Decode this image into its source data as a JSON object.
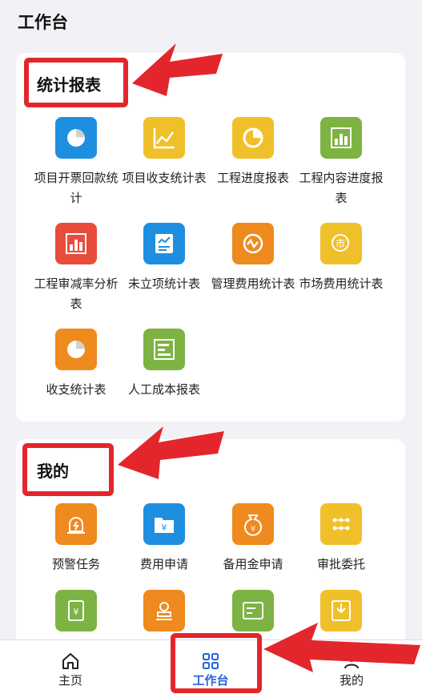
{
  "header": {
    "title": "工作台"
  },
  "reports": {
    "title": "统计报表",
    "items": [
      {
        "label": "项目开票回款统计",
        "icon": "pie-chart-icon",
        "color": "#1e8fe0"
      },
      {
        "label": "项目收支统计表",
        "icon": "line-chart-icon",
        "color": "#f0c02a"
      },
      {
        "label": "工程进度报表",
        "icon": "progress-pie-icon",
        "color": "#f0c02a"
      },
      {
        "label": "工程内容进度报表",
        "icon": "bar-chart-icon",
        "color": "#7cb342"
      },
      {
        "label": "工程审减率分析表",
        "icon": "bar-chart-icon",
        "color": "#e84c3d"
      },
      {
        "label": "未立项统计表",
        "icon": "report-icon",
        "color": "#1e8fe0"
      },
      {
        "label": "管理费用统计表",
        "icon": "cycle-icon",
        "color": "#ef8a1e"
      },
      {
        "label": "市场费用统计表",
        "icon": "market-icon",
        "color": "#f0c02a"
      },
      {
        "label": "收支统计表",
        "icon": "pie-chart-icon",
        "color": "#ef8a1e"
      },
      {
        "label": "人工成本报表",
        "icon": "gantt-icon",
        "color": "#7cb342"
      }
    ]
  },
  "mine": {
    "title": "我的",
    "items": [
      {
        "label": "预警任务",
        "icon": "alarm-icon",
        "color": "#ef8a1e"
      },
      {
        "label": "费用申请",
        "icon": "folder-yuan-icon",
        "color": "#1e8fe0"
      },
      {
        "label": "备用金申请",
        "icon": "money-bag-icon",
        "color": "#ef8a1e"
      },
      {
        "label": "审批委托",
        "icon": "flow-icon",
        "color": "#f0c02a"
      },
      {
        "label": "",
        "icon": "scroll-yuan-icon",
        "color": "#7cb342"
      },
      {
        "label": "",
        "icon": "stamp-icon",
        "color": "#ef8a1e"
      },
      {
        "label": "",
        "icon": "card-icon",
        "color": "#7cb342"
      },
      {
        "label": "",
        "icon": "inbox-download-icon",
        "color": "#f0c02a"
      }
    ]
  },
  "tabbar": {
    "tabs": [
      {
        "label": "主页",
        "icon": "home-icon"
      },
      {
        "label": "工作台",
        "icon": "grid-icon",
        "active": true
      },
      {
        "label": "我的",
        "icon": "user-icon"
      }
    ]
  },
  "accent": "#2563d8",
  "highlight_color": "#e3262c"
}
